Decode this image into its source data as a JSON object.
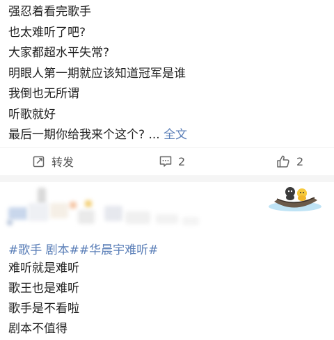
{
  "post1": {
    "lines": [
      "强忍着看完歌手",
      "也太难听了吧?",
      "大家都超水平失常?",
      "明眼人第一期就应该知道冠军是谁",
      "我倒也无所谓",
      "听歌就好",
      "最后一期你给我来个这个?"
    ],
    "ellipsis": "...",
    "full_text_link": "全文",
    "actions": {
      "repost_label": "转发",
      "comment_count": "2",
      "like_count": "2"
    }
  },
  "post2": {
    "tags": "#歌手 剧本##华晨宇难听#",
    "lines": [
      "难听就是难听",
      "歌王也是难听",
      "歌手是不看啦",
      "剧本不值得"
    ]
  },
  "colors": {
    "link": "#5b7fb8",
    "text": "#222222",
    "divider": "#f5f5f5"
  },
  "icons": [
    "repost-icon",
    "comment-icon",
    "like-icon",
    "avatar-boat-icon"
  ]
}
